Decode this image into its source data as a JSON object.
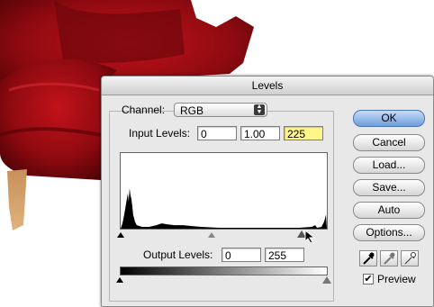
{
  "dialog": {
    "title": "Levels",
    "channel": {
      "label": "Channel:",
      "value": "RGB"
    },
    "input_levels": {
      "label": "Input Levels:",
      "black": "0",
      "gamma": "1.00",
      "white": "225"
    },
    "output_levels": {
      "label": "Output Levels:",
      "black": "0",
      "white": "255"
    },
    "buttons": {
      "ok": "OK",
      "cancel": "Cancel",
      "load": "Load...",
      "save": "Save...",
      "auto": "Auto",
      "options": "Options..."
    },
    "preview": {
      "label": "Preview",
      "checked": true
    },
    "colors": {
      "highlight": "#fff58a",
      "default_button": "#6f9fdc"
    }
  }
}
